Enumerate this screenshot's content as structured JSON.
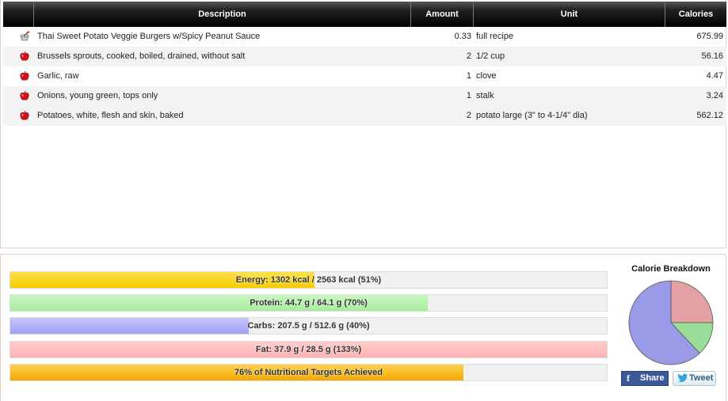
{
  "table": {
    "headers": {
      "description": "Description",
      "amount": "Amount",
      "unit": "Unit",
      "calories": "Calories"
    },
    "rows": [
      {
        "icon": "recipe-icon",
        "description": "Thai Sweet Potato Veggie Burgers w/Spicy Peanut Sauce",
        "amount": "0.33",
        "unit": "full recipe",
        "calories": "675.99"
      },
      {
        "icon": "apple-icon",
        "description": "Brussels sprouts, cooked, boiled, drained, without salt",
        "amount": "2",
        "unit": "1/2 cup",
        "calories": "56.16"
      },
      {
        "icon": "apple-icon",
        "description": "Garlic, raw",
        "amount": "1",
        "unit": "clove",
        "calories": "4.47"
      },
      {
        "icon": "apple-icon",
        "description": "Onions, young green, tops only",
        "amount": "1",
        "unit": "stalk",
        "calories": "3.24"
      },
      {
        "icon": "apple-icon",
        "description": "Potatoes, white, flesh and skin, baked",
        "amount": "2",
        "unit": "potato large (3\" to 4-1/4\" dia)",
        "calories": "562.12"
      }
    ]
  },
  "nutrition": {
    "bars": [
      {
        "key": "energy",
        "label": "Energy: 1302 kcal / 2563 kcal (51%)",
        "fraction": 0.51,
        "color": "#f5cc00"
      },
      {
        "key": "protein",
        "label": "Protein: 44.7 g / 64.1 g (70%)",
        "fraction": 0.7,
        "color": "#a8ec9e"
      },
      {
        "key": "carbs",
        "label": "Carbs: 207.5 g / 512.6 g (40%)",
        "fraction": 0.4,
        "color": "#a2a2f5"
      },
      {
        "key": "fat",
        "label": "Fat: 37.9 g / 28.5 g (133%)",
        "fraction": 1.0,
        "color": "#ffb3b3"
      },
      {
        "key": "targets",
        "label": "76% of Nutritional Targets Achieved",
        "fraction": 0.76,
        "color": "#f2a800"
      }
    ]
  },
  "calorie_breakdown": {
    "title": "Calorie Breakdown",
    "slices": [
      {
        "share": 0.25,
        "color": "#e5a0a4"
      },
      {
        "share": 0.13,
        "color": "#99dd99"
      },
      {
        "share": 0.62,
        "color": "#9a9ae8"
      }
    ]
  },
  "social": {
    "share_label": "Share",
    "tweet_label": "Tweet"
  }
}
